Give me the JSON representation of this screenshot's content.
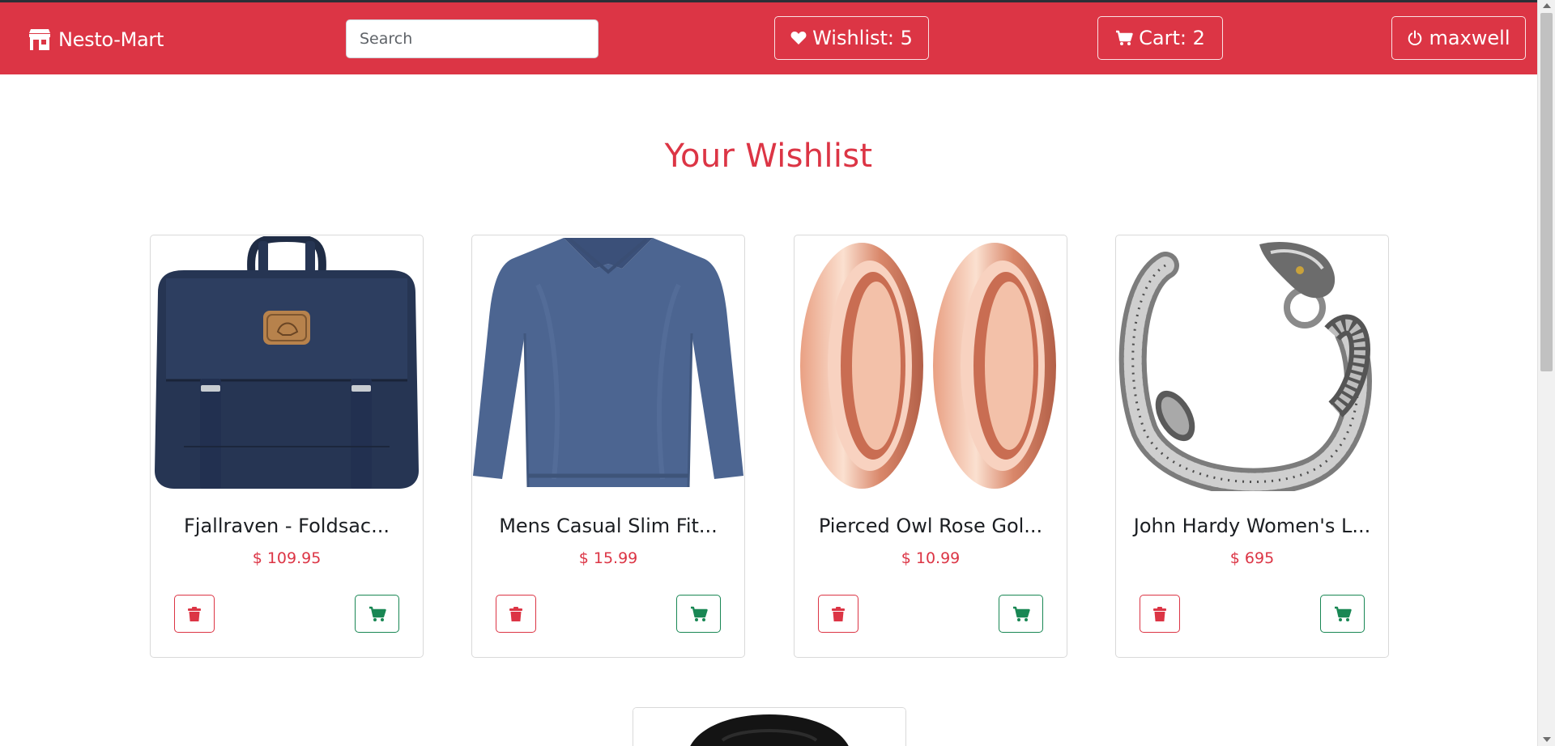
{
  "navbar": {
    "brand": "Nesto-Mart",
    "search_placeholder": "Search",
    "wishlist_label": "Wishlist: 5",
    "cart_label": "Cart: 2",
    "user_label": "maxwell"
  },
  "page": {
    "title": "Your Wishlist"
  },
  "products": [
    {
      "title": "Fjallraven - Foldsac...",
      "price": "$ 109.95",
      "image": "navy-backpack"
    },
    {
      "title": "Mens Casual Slim Fit...",
      "price": "$ 15.99",
      "image": "blue-long-sleeve-shirt"
    },
    {
      "title": "Pierced Owl Rose Gol...",
      "price": "$ 10.99",
      "image": "rose-gold-tunnel-plugs"
    },
    {
      "title": "John Hardy Women's L...",
      "price": "$ 695",
      "image": "silver-dragon-bracelet"
    }
  ],
  "colors": {
    "brand": "#dc3545",
    "success": "#198754"
  }
}
